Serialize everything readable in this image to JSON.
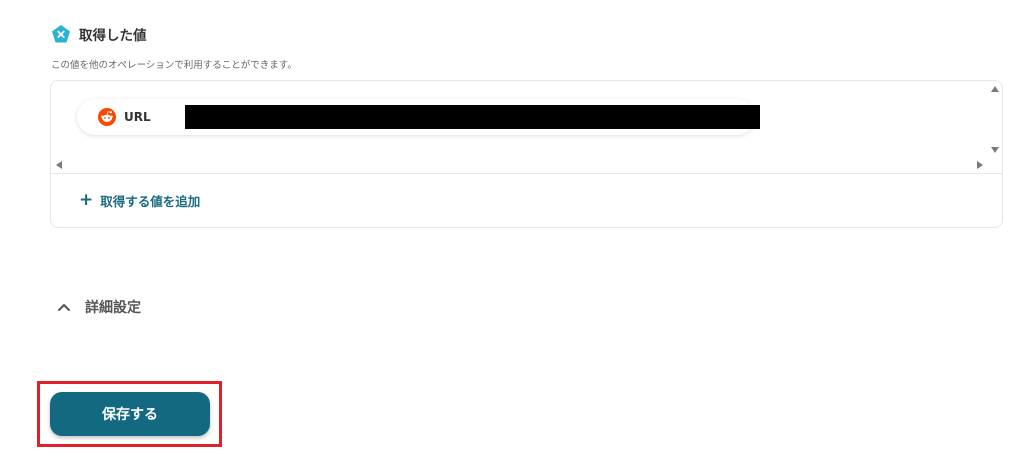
{
  "section": {
    "title": "取得した値",
    "description": "この値を他のオペレーションで利用することができます。"
  },
  "values": [
    {
      "label": "URL",
      "icon": "reddit-icon"
    }
  ],
  "add_value_label": "取得する値を追加",
  "advanced_settings": {
    "label": "詳細設定",
    "icon": "chevron-up-icon",
    "expanded": true
  },
  "save_button": {
    "label": "保存する"
  },
  "colors": {
    "accent": "#136a80",
    "link": "#1a6b80",
    "highlight": "#e0202a",
    "icon_pentagon": "#2bb3d6",
    "reddit": "#ff4500"
  }
}
